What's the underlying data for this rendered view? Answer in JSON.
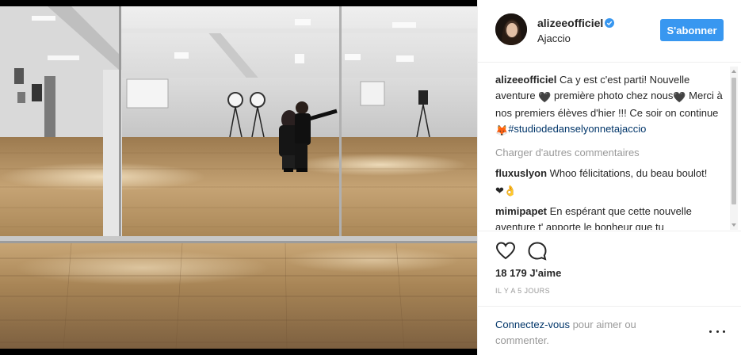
{
  "post": {
    "photo_alt": "",
    "username": "alizeeofficiel",
    "verified_icon": "verified-badge-icon",
    "location": "Ajaccio",
    "follow_label": "S'abonner"
  },
  "caption": {
    "username": "alizeeofficiel",
    "text_part1": "Ca y est c'est parti! Nouvelle aventure",
    "emoji1": "🖤",
    "text_part2": "première photo chez nous",
    "emoji2": "🖤",
    "text_part3": "Merci à nos premiers élèves d'hier !!! Ce soir on continue",
    "emoji3": "🦊",
    "hashtag": "#studiodedanselyonnetajaccio"
  },
  "load_more_label": "Charger d'autres commentaires",
  "comments": [
    {
      "username": "fluxuslyon",
      "text": "Whoo félicitations, du beau boulot!",
      "emoji": "❤👌"
    },
    {
      "username": "mimipapet",
      "text": "En espérant que cette nouvelle aventure t' apporte le bonheur que tu"
    }
  ],
  "actions": {
    "like_icon": "heart-icon",
    "comment_icon": "comment-icon"
  },
  "likes": "18 179 J'aime",
  "timestamp": "IL Y A 5 JOURS",
  "footer": {
    "login_link": "Connectez-vous",
    "login_text": " pour aimer ou commenter.",
    "more_icon": "more-options-icon"
  },
  "colors": {
    "accent": "#3897f0",
    "link": "#003569",
    "muted": "#999999",
    "text": "#262626",
    "floor": "#b08a5a"
  }
}
